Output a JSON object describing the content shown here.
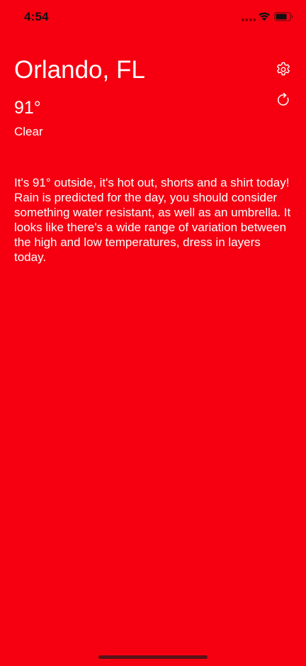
{
  "status_bar": {
    "time": "4:54",
    "time_color": "#111111",
    "icons": [
      "cellular-signal-icon",
      "wifi-icon",
      "battery-icon"
    ]
  },
  "header": {
    "city": "Orlando, FL",
    "settings_icon": "gear-icon",
    "refresh_icon": "refresh-icon"
  },
  "weather": {
    "temperature": "91°",
    "condition": "Clear"
  },
  "advice": {
    "text": "It's 91° outside, it's hot out, shorts and a shirt today! Rain is predicted for the day, you should consider something water resistant, as well as an umbrella. It looks like there's a wide range of variation between the high and low temperatures, dress in layers today."
  },
  "theme": {
    "background": "#f60011",
    "text": "#ffffff"
  }
}
